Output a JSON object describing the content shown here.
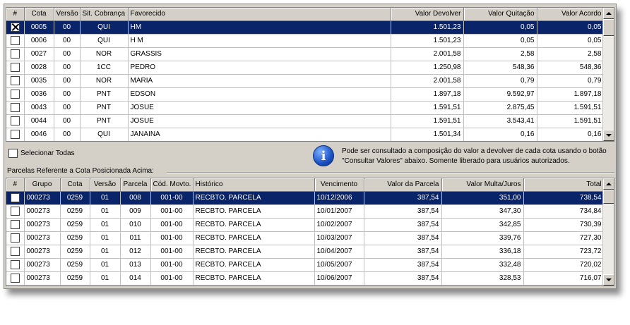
{
  "cotas": {
    "columns": [
      "#",
      "Cota",
      "Versão",
      "Sit. Cobrança",
      "Favorecido",
      "Valor Devolver",
      "Valor Quitação",
      "Valor Acordo"
    ],
    "rows": [
      {
        "checked": true,
        "cota": "0005",
        "versao": "00",
        "sit": "QUI",
        "fav": "HM",
        "devolver": "1.501,23",
        "quitacao": "0,05",
        "acordo": "0,05"
      },
      {
        "checked": false,
        "cota": "0006",
        "versao": "00",
        "sit": "QUI",
        "fav": "H M",
        "devolver": "1.501,23",
        "quitacao": "0,05",
        "acordo": "0,05"
      },
      {
        "checked": false,
        "cota": "0027",
        "versao": "00",
        "sit": "NOR",
        "fav": "GRASSIS",
        "devolver": "2.001,58",
        "quitacao": "2,58",
        "acordo": "2,58"
      },
      {
        "checked": false,
        "cota": "0028",
        "versao": "00",
        "sit": "1CC",
        "fav": "PEDRO",
        "devolver": "1.250,98",
        "quitacao": "548,36",
        "acordo": "548,36"
      },
      {
        "checked": false,
        "cota": "0035",
        "versao": "00",
        "sit": "NOR",
        "fav": "MARIA",
        "devolver": "2.001,58",
        "quitacao": "0,79",
        "acordo": "0,79"
      },
      {
        "checked": false,
        "cota": "0036",
        "versao": "00",
        "sit": "PNT",
        "fav": "EDSON",
        "devolver": "1.897,18",
        "quitacao": "9.592,97",
        "acordo": "1.897,18"
      },
      {
        "checked": false,
        "cota": "0043",
        "versao": "00",
        "sit": "PNT",
        "fav": "JOSUE",
        "devolver": "1.591,51",
        "quitacao": "2.875,45",
        "acordo": "1.591,51"
      },
      {
        "checked": false,
        "cota": "0044",
        "versao": "00",
        "sit": "PNT",
        "fav": "JOSUE",
        "devolver": "1.591,51",
        "quitacao": "3.543,41",
        "acordo": "1.591,51"
      },
      {
        "checked": false,
        "cota": "0046",
        "versao": "00",
        "sit": "QUI",
        "fav": "JANAINA",
        "devolver": "1.501,34",
        "quitacao": "0,16",
        "acordo": "0,16"
      }
    ],
    "selected_row": 0,
    "scroll_position": 0.0
  },
  "select_all_label": "Selecionar Todas",
  "info_message": "Pode ser consultado a composição do valor a devolver de cada cota usando o botão \"Consultar Valores\" abaixo. Somente liberado para usuários autorizados.",
  "info_icon": "info-icon",
  "parcelas_label": "Parcelas Referente a Cota Posicionada Acima:",
  "parcelas": {
    "columns": [
      "#",
      "Grupo",
      "Cota",
      "Versão",
      "Parcela",
      "Cód. Movto.",
      "Histórico",
      "Vencimento",
      "Valor da Parcela",
      "Valor Multa/Juros",
      "Total"
    ],
    "rows": [
      {
        "grupo": "000273",
        "cota": "0259",
        "versao": "01",
        "parcela": "008",
        "cod": "001-00",
        "hist": "RECBTO. PARCELA",
        "venc": "10/12/2006",
        "valor": "387,54",
        "multa": "351,00",
        "total": "738,54"
      },
      {
        "grupo": "000273",
        "cota": "0259",
        "versao": "01",
        "parcela": "009",
        "cod": "001-00",
        "hist": "RECBTO. PARCELA",
        "venc": "10/01/2007",
        "valor": "387,54",
        "multa": "347,30",
        "total": "734,84"
      },
      {
        "grupo": "000273",
        "cota": "0259",
        "versao": "01",
        "parcela": "010",
        "cod": "001-00",
        "hist": "RECBTO. PARCELA",
        "venc": "10/02/2007",
        "valor": "387,54",
        "multa": "342,85",
        "total": "730,39"
      },
      {
        "grupo": "000273",
        "cota": "0259",
        "versao": "01",
        "parcela": "011",
        "cod": "001-00",
        "hist": "RECBTO. PARCELA",
        "venc": "10/03/2007",
        "valor": "387,54",
        "multa": "339,76",
        "total": "727,30"
      },
      {
        "grupo": "000273",
        "cota": "0259",
        "versao": "01",
        "parcela": "012",
        "cod": "001-00",
        "hist": "RECBTO. PARCELA",
        "venc": "10/04/2007",
        "valor": "387,54",
        "multa": "336,18",
        "total": "723,72"
      },
      {
        "grupo": "000273",
        "cota": "0259",
        "versao": "01",
        "parcela": "013",
        "cod": "001-00",
        "hist": "RECBTO. PARCELA",
        "venc": "10/05/2007",
        "valor": "387,54",
        "multa": "332,48",
        "total": "720,02"
      },
      {
        "grupo": "000273",
        "cota": "0259",
        "versao": "01",
        "parcela": "014",
        "cod": "001-00",
        "hist": "RECBTO. PARCELA",
        "venc": "10/06/2007",
        "valor": "387,54",
        "multa": "328,53",
        "total": "716,07"
      }
    ],
    "selected_row": 0,
    "scroll_position": 0.0
  },
  "colors": {
    "selection": "#0a246a",
    "panel": "#d4d0c8"
  }
}
